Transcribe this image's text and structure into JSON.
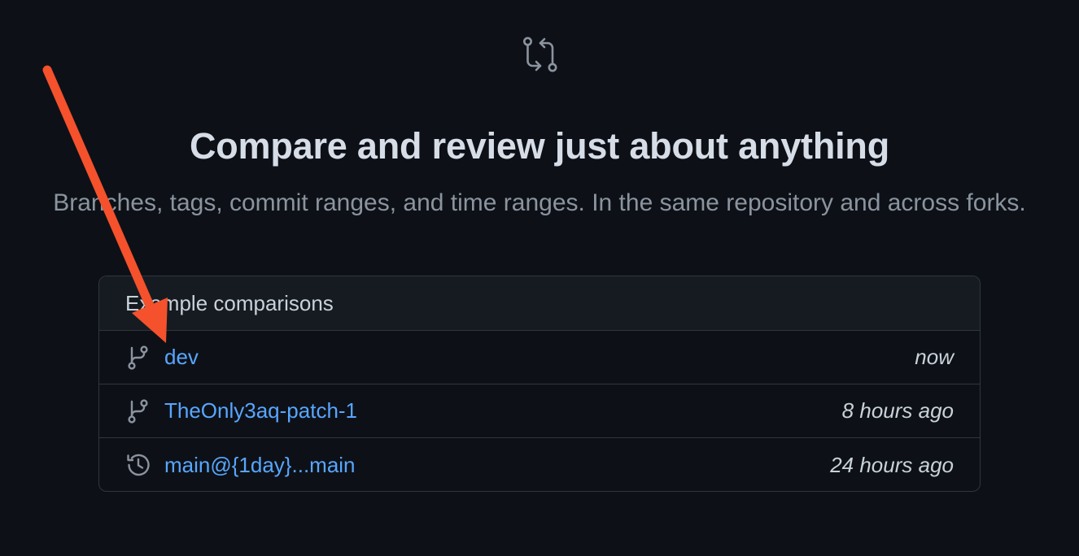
{
  "header": {
    "title": "Compare and review just about anything",
    "subtitle": "Branches, tags, commit ranges, and time ranges. In the same repository and across forks."
  },
  "examples": {
    "heading": "Example comparisons",
    "rows": [
      {
        "label": "dev",
        "time": "now",
        "icon": "git-branch-icon"
      },
      {
        "label": "TheOnly3aq-patch-1",
        "time": "8 hours ago",
        "icon": "git-branch-icon"
      },
      {
        "label": "main@{1day}...main",
        "time": "24 hours ago",
        "icon": "history-icon"
      }
    ]
  },
  "colors": {
    "background": "#0d1117",
    "link": "#58a6ff",
    "annotation_arrow": "#f4512c"
  }
}
